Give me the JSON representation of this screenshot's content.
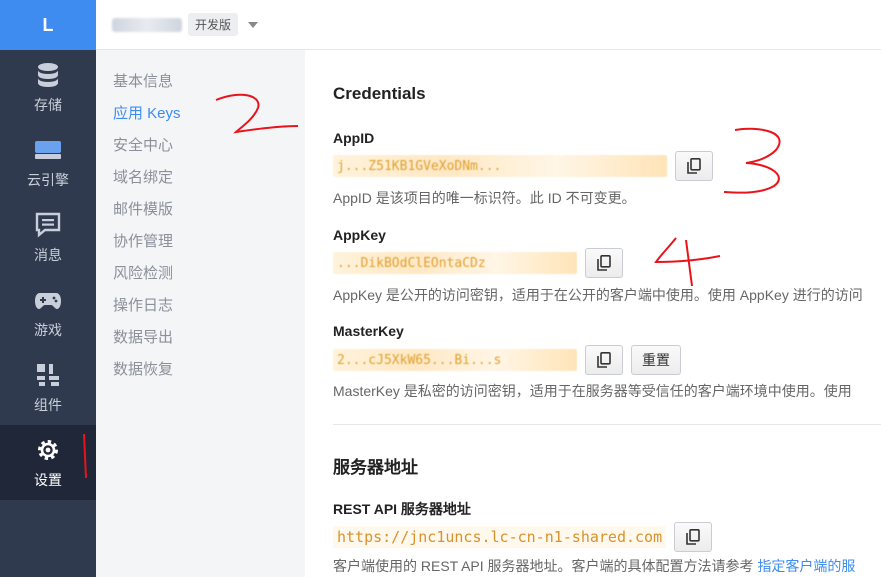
{
  "rail": {
    "logo": "L",
    "items": [
      {
        "label": "存储",
        "icon": "database-icon"
      },
      {
        "label": "云引擎",
        "icon": "cloud-engine-icon"
      },
      {
        "label": "消息",
        "icon": "message-icon"
      },
      {
        "label": "游戏",
        "icon": "gamepad-icon"
      },
      {
        "label": "组件",
        "icon": "components-icon"
      },
      {
        "label": "设置",
        "icon": "gear-icon"
      }
    ]
  },
  "topbar": {
    "env_badge": "开发版"
  },
  "subnav": {
    "items": [
      "基本信息",
      "应用 Keys",
      "安全中心",
      "域名绑定",
      "邮件模版",
      "协作管理",
      "风险检测",
      "操作日志",
      "数据导出",
      "数据恢复"
    ]
  },
  "main": {
    "credentials_title": "Credentials",
    "appid": {
      "label": "AppID",
      "value": "j...Z51KB1GVeXoDNm...",
      "desc": "AppID 是该项目的唯一标识符。此 ID 不可变更。"
    },
    "appkey": {
      "label": "AppKey",
      "value": "...DikBOdClEOntaCDz",
      "desc": "AppKey 是公开的访问密钥，适用于在公开的客户端中使用。使用 AppKey 进行的访问"
    },
    "masterkey": {
      "label": "MasterKey",
      "value": "2...cJ5XkW65...Bi...s",
      "reset_label": "重置",
      "desc": "MasterKey 是私密的访问密钥，适用于在服务器等受信任的客户端环境中使用。使用"
    },
    "server_title": "服务器地址",
    "rest": {
      "label": "REST API 服务器地址",
      "url": "https://jnc1uncs.lc-cn-n1-shared.com",
      "desc": "客户端使用的 REST API 服务器地址。客户端的具体配置方法请参考",
      "link": "指定客户端的服"
    }
  },
  "colors": {
    "accent": "#3f8cf0",
    "rail_bg": "#2f3a4e",
    "annotation": "#e8141b"
  }
}
